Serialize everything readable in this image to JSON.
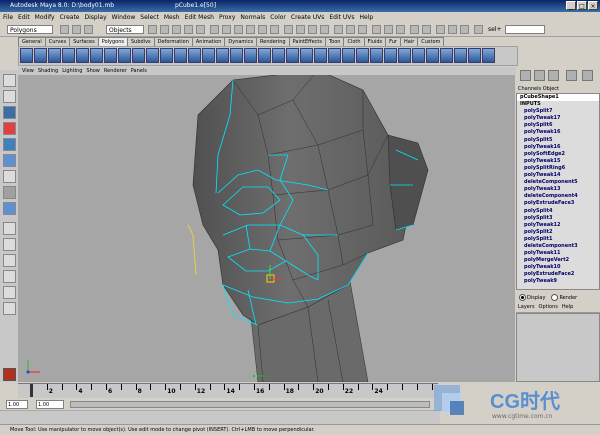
{
  "window": {
    "app_title": "Autodesk Maya 8.0: D:\\body01.mb",
    "selection_title": "pCube1.e[50]"
  },
  "menubar": {
    "items": [
      "File",
      "Edit",
      "Modify",
      "Create",
      "Display",
      "Window",
      "Select",
      "Mesh",
      "Edit Mesh",
      "Proxy",
      "Normals",
      "Color",
      "Create UVs",
      "Edit UVs",
      "Help"
    ]
  },
  "statusline": {
    "menu_set": "Polygons",
    "selection_mode": "Objects",
    "input_label": "sel+",
    "input_value": ""
  },
  "shelf": {
    "tabs": [
      "General",
      "Curves",
      "Surfaces",
      "Polygons",
      "Subdivs",
      "Deformation",
      "Animation",
      "Dynamics",
      "Rendering",
      "PaintEffects",
      "Toon",
      "Cloth",
      "Fluids",
      "Fur",
      "Hair",
      "Custom"
    ],
    "active_tab": "Polygons"
  },
  "panel_menu": [
    "View",
    "Shading",
    "Lighting",
    "Show",
    "Renderer",
    "Panels"
  ],
  "channel_box": {
    "menu_label": "Channels Object",
    "shape": "pCubeShape1",
    "inputs_label": "INPUTS",
    "nodes": [
      "polySplit7",
      "polyTweak17",
      "polySplit6",
      "polyTweak16",
      "polySplit5",
      "polyTweak16",
      "polySoftEdge2",
      "polyTweak15",
      "polySplitRing6",
      "polyTweak14",
      "deleteComponent5",
      "polyTweak13",
      "deleteComponent4",
      "polyExtrudeFace3",
      "polySplit4",
      "polySplit3",
      "polyTweak12",
      "polySplit2",
      "polySplit1",
      "deleteComponent3",
      "polyTweak11",
      "polyMergeVert2",
      "polyTweak10",
      "polyExtrudeFace2",
      "polyTweak9"
    ]
  },
  "display_mode": {
    "display": "Display",
    "render": "Render",
    "selected": "Display"
  },
  "layers_menu": [
    "Layers",
    "Options",
    "Help"
  ],
  "time_slider": {
    "tick_labels": [
      "2",
      "4",
      "6",
      "8",
      "10",
      "12",
      "14",
      "16",
      "18",
      "20",
      "22",
      "24"
    ]
  },
  "range_slider": {
    "start_time": "1.00",
    "range_start": "1.00"
  },
  "help_line": "Move Tool: Use manipulator to move object(s). Use edit mode to change pivot (INSERT). Ctrl+LMB to move perpendicular.",
  "watermark": {
    "brand": "CG时代",
    "url": "www.cgtime.com.cn"
  },
  "colors": {
    "viewport_bg": "#a6a6a6",
    "wire_highlight": "#00ffff",
    "titlebar": "#0a246a"
  }
}
